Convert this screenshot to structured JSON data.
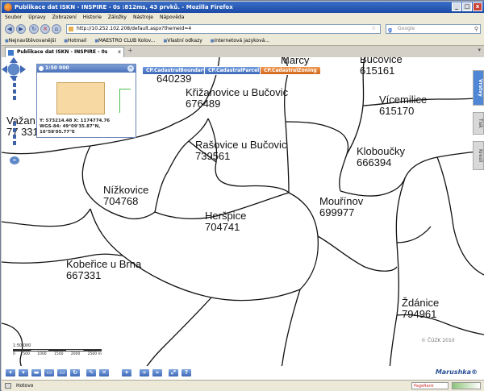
{
  "window": {
    "title": "Publikace dat ISKN - INSPIRE - 0s :812ms, 43 prvků. - Mozilla Firefox",
    "buttons": [
      "_",
      "□",
      "x"
    ]
  },
  "menu": [
    "Soubor",
    "Úpravy",
    "Zobrazení",
    "Historie",
    "Záložky",
    "Nástroje",
    "Nápověda"
  ],
  "nav": {
    "url": "http://10.252.102.208/default.aspx?themeid=4",
    "search_placeholder": "Google",
    "search_engine_icon": "google-icon"
  },
  "bookmarks": [
    "Nejnavštěvovanější",
    "Hotmail",
    "MAESTRO CLUB Kolov...",
    "Vlastní odkazy",
    "Internetová jazyková..."
  ],
  "tab": {
    "label": "Publikace dat ISKN - INSPIRE - 0s :81...",
    "close": "x",
    "new": "+"
  },
  "overview": {
    "scale": "1:50 000",
    "coord_line1": "Y: 573214.48 X: 1174774.76",
    "coord_line2": "WGS-84: 49°09'35.87\"N, 16°58'05.77\"E"
  },
  "layer_buttons": [
    "CP.CadastralBoundary",
    "CP.CadastralParcel",
    "CP.CadastralZoning"
  ],
  "side_tabs": [
    "Vrstvy",
    "Tisk",
    "Kresli"
  ],
  "labels": [
    {
      "name": "partial-top-left",
      "text": "640239"
    },
    {
      "name": "krizanovice",
      "text": "Křižanovice u Bučovic\n676489"
    },
    {
      "name": "marcy",
      "text": "Marcy"
    },
    {
      "name": "bucovice",
      "text": "Bučovice\n615161"
    },
    {
      "name": "vicemilice",
      "text": "Vícemilice\n615170"
    },
    {
      "name": "vazany",
      "text": "Važan\n77 331"
    },
    {
      "name": "rasovice",
      "text": "Rašovice u Bučovic\n739561"
    },
    {
      "name": "kloboucky",
      "text": "Kloboučky\n666394"
    },
    {
      "name": "nizkovice",
      "text": "Nížkovice\n704768"
    },
    {
      "name": "mourinov",
      "text": "Mouřínov\n699977"
    },
    {
      "name": "herspice",
      "text": "Heršpice\n704741"
    },
    {
      "name": "kobertice",
      "text": "Kobeřice u Brna\n667331"
    },
    {
      "name": "zdanice",
      "text": "Ždánice\n794961"
    }
  ],
  "scale": {
    "label": "1:50 000",
    "ticks": [
      "0",
      "500",
      "1000",
      "1500",
      "2000",
      "2500 m"
    ]
  },
  "copyright": "© ČÚZK 2010",
  "brand": "Marushka®",
  "status": {
    "text": "Hotovo",
    "pagerank": "PageRank"
  },
  "colors": {
    "accent": "#3e67b6",
    "zoning_button": "#d0661e",
    "overview_extent": "#f6d9a3"
  }
}
